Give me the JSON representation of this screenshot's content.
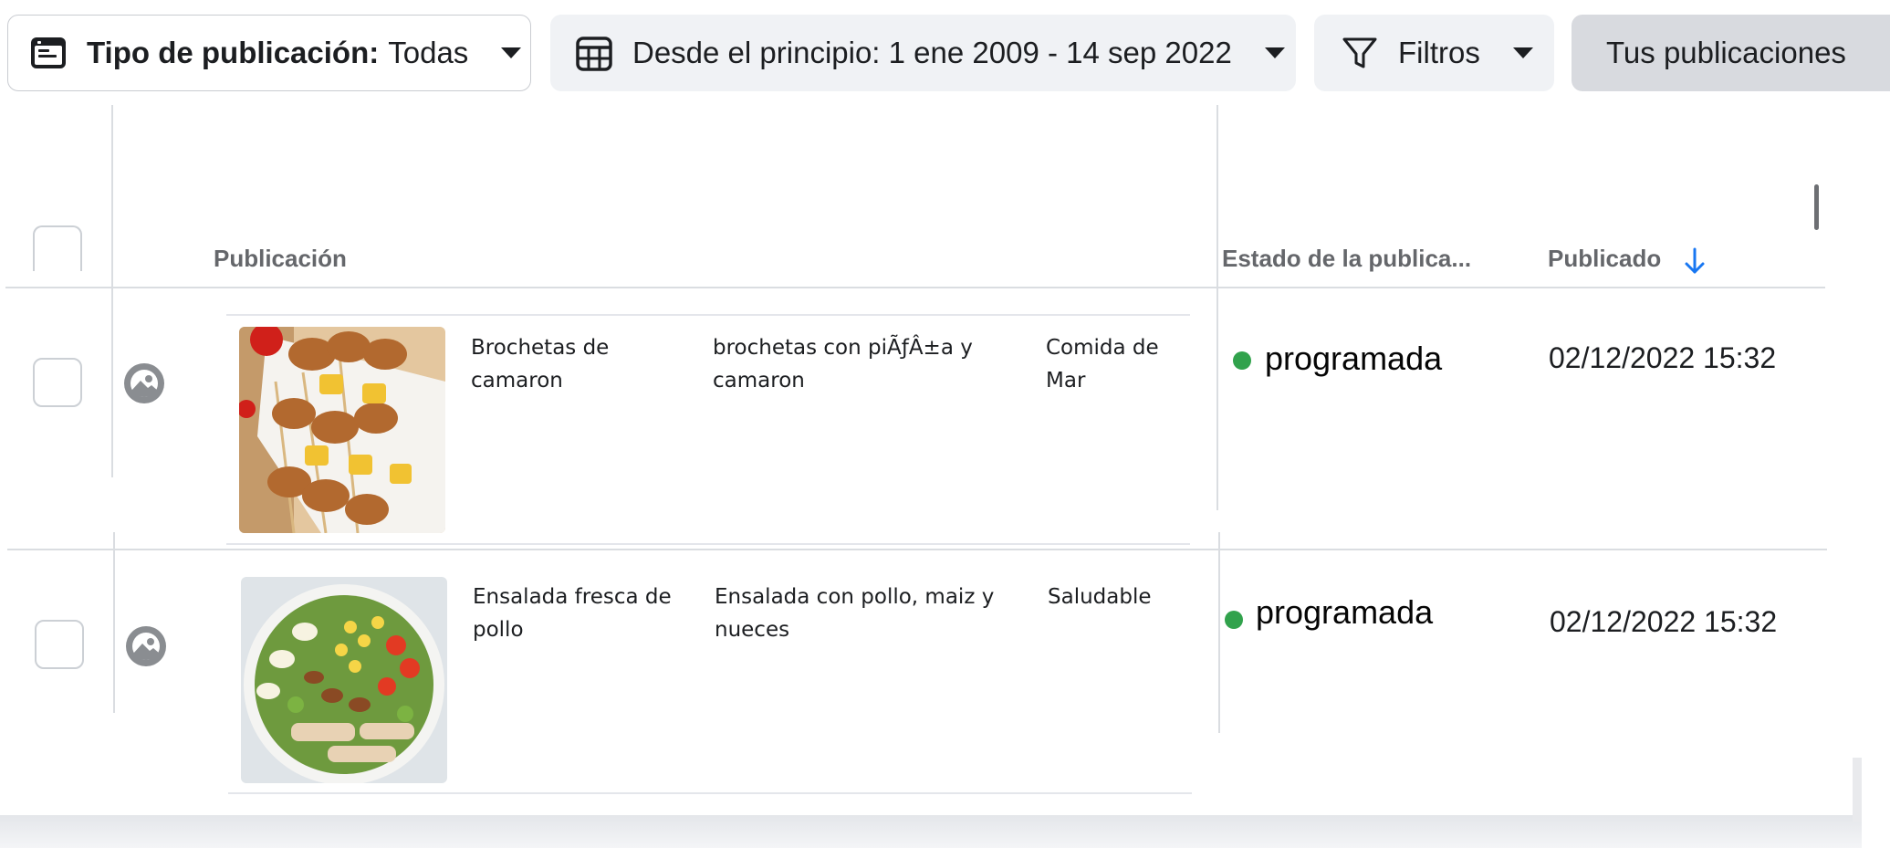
{
  "toolbar": {
    "post_type_label": "Tipo de publicación:",
    "post_type_value": "Todas",
    "date_range": "Desde el principio: 1 ene 2009 - 14 sep 2022",
    "filters": "Filtros",
    "your_posts": "Tus publicaciones"
  },
  "table": {
    "headers": {
      "post": "Publicación",
      "status": "Estado de la publica...",
      "published": "Publicado"
    },
    "rows": [
      {
        "title": "Brochetas de camaron",
        "description": "brochetas con piÃƒÂ±a y camaron",
        "category": "Comida de Mar",
        "status": "programada",
        "date": "02/12/2022 15:32",
        "thumbnail": "shrimp-pineapple-skewers"
      },
      {
        "title": "Ensalada fresca de pollo",
        "description": "Ensalada con pollo, maiz y nueces",
        "category": "Saludable",
        "status": "programada",
        "date": "02/12/2022 15:32",
        "thumbnail": "chicken-salad-bowl"
      }
    ]
  },
  "colors": {
    "status_scheduled": "#31a24c",
    "sort_arrow": "#1877f2",
    "divider": "#dadde1"
  }
}
